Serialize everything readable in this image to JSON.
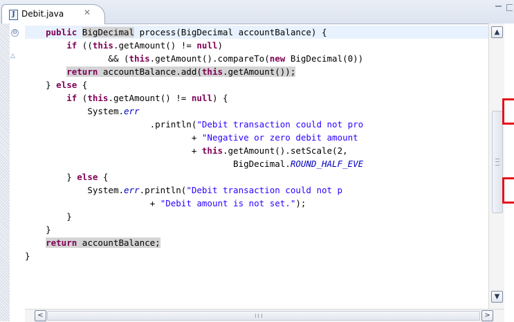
{
  "tab": {
    "icon": "java-file-icon",
    "label": "Debit.java",
    "close_glyph": "✕"
  },
  "window_controls": {
    "minimize_icon": "minimize-icon",
    "maximize_icon": "maximize-icon"
  },
  "gutter": {
    "marker_glyph": "△",
    "fold_glyph": "⊖"
  },
  "code_lines": [
    {
      "indent": 4,
      "tokens": [
        {
          "t": "public ",
          "c": "kw"
        },
        {
          "t": "BigDecimal",
          "c": "hl"
        },
        {
          "t": " process(BigDecimal accountBalance) {",
          "c": ""
        }
      ]
    },
    {
      "indent": 8,
      "tokens": [
        {
          "t": "if",
          "c": "kw"
        },
        {
          "t": " ((",
          "c": ""
        },
        {
          "t": "this",
          "c": "kw"
        },
        {
          "t": ".getAmount() != ",
          "c": ""
        },
        {
          "t": "null",
          "c": "kw"
        },
        {
          "t": ")",
          "c": ""
        }
      ]
    },
    {
      "indent": 16,
      "tokens": [
        {
          "t": "&& (",
          "c": ""
        },
        {
          "t": "this",
          "c": "kw"
        },
        {
          "t": ".getAmount().compareTo(",
          "c": ""
        },
        {
          "t": "new",
          "c": "kw"
        },
        {
          "t": " BigDecimal(0))",
          "c": ""
        }
      ]
    },
    {
      "indent": 8,
      "tokens": [
        {
          "t": "return",
          "c": "kw hl"
        },
        {
          "t": " accountBalance.add(",
          "c": "hl"
        },
        {
          "t": "this",
          "c": "kw hl"
        },
        {
          "t": ".getAmount());",
          "c": "hl"
        }
      ]
    },
    {
      "indent": 4,
      "tokens": [
        {
          "t": "} ",
          "c": ""
        },
        {
          "t": "else",
          "c": "kw"
        },
        {
          "t": " {",
          "c": ""
        }
      ]
    },
    {
      "indent": 8,
      "tokens": [
        {
          "t": "if",
          "c": "kw"
        },
        {
          "t": " (",
          "c": ""
        },
        {
          "t": "this",
          "c": "kw"
        },
        {
          "t": ".getAmount() != ",
          "c": ""
        },
        {
          "t": "null",
          "c": "kw"
        },
        {
          "t": ") {",
          "c": ""
        }
      ]
    },
    {
      "indent": 12,
      "tokens": [
        {
          "t": "System.",
          "c": ""
        },
        {
          "t": "err",
          "c": "fld"
        }
      ]
    },
    {
      "indent": 24,
      "tokens": [
        {
          "t": ".println(",
          "c": ""
        },
        {
          "t": "\"Debit transaction could not pro",
          "c": "str"
        }
      ]
    },
    {
      "indent": 32,
      "tokens": [
        {
          "t": "+ ",
          "c": ""
        },
        {
          "t": "\"Negative or zero debit amount ",
          "c": "str"
        }
      ]
    },
    {
      "indent": 32,
      "tokens": [
        {
          "t": "+ ",
          "c": ""
        },
        {
          "t": "this",
          "c": "kw"
        },
        {
          "t": ".getAmount().setScale(2,",
          "c": ""
        }
      ]
    },
    {
      "indent": 40,
      "tokens": [
        {
          "t": "BigDecimal.",
          "c": ""
        },
        {
          "t": "ROUND_HALF_EVE",
          "c": "fld"
        }
      ]
    },
    {
      "indent": 8,
      "tokens": [
        {
          "t": "} ",
          "c": ""
        },
        {
          "t": "else",
          "c": "kw"
        },
        {
          "t": " {",
          "c": ""
        }
      ]
    },
    {
      "indent": 12,
      "tokens": [
        {
          "t": "System.",
          "c": ""
        },
        {
          "t": "err",
          "c": "fld"
        },
        {
          "t": ".println(",
          "c": ""
        },
        {
          "t": "\"Debit transaction could not p",
          "c": "str"
        }
      ]
    },
    {
      "indent": 24,
      "tokens": [
        {
          "t": "+ ",
          "c": ""
        },
        {
          "t": "\"Debit amount is not set.\"",
          "c": "str"
        },
        {
          "t": ");",
          "c": ""
        }
      ]
    },
    {
      "indent": 8,
      "tokens": [
        {
          "t": "}",
          "c": ""
        }
      ]
    },
    {
      "indent": 4,
      "tokens": [
        {
          "t": "}",
          "c": ""
        }
      ]
    },
    {
      "indent": 4,
      "tokens": [
        {
          "t": "return",
          "c": "kw hl"
        },
        {
          "t": " accountBalance;",
          "c": "hl"
        }
      ]
    },
    {
      "indent": 0,
      "tokens": [
        {
          "t": "}",
          "c": ""
        }
      ]
    }
  ],
  "scrollbars": {
    "up_glyph": "▲",
    "down_glyph": "▼",
    "left_glyph": "<",
    "right_glyph": ">"
  },
  "colors": {
    "keyword": "#7f0055",
    "string": "#2a00ff",
    "field": "#0000c0",
    "current_line": "#e8f2fe",
    "occurrence_highlight": "#d4d4d4",
    "annotation_box": "#e4121a"
  }
}
